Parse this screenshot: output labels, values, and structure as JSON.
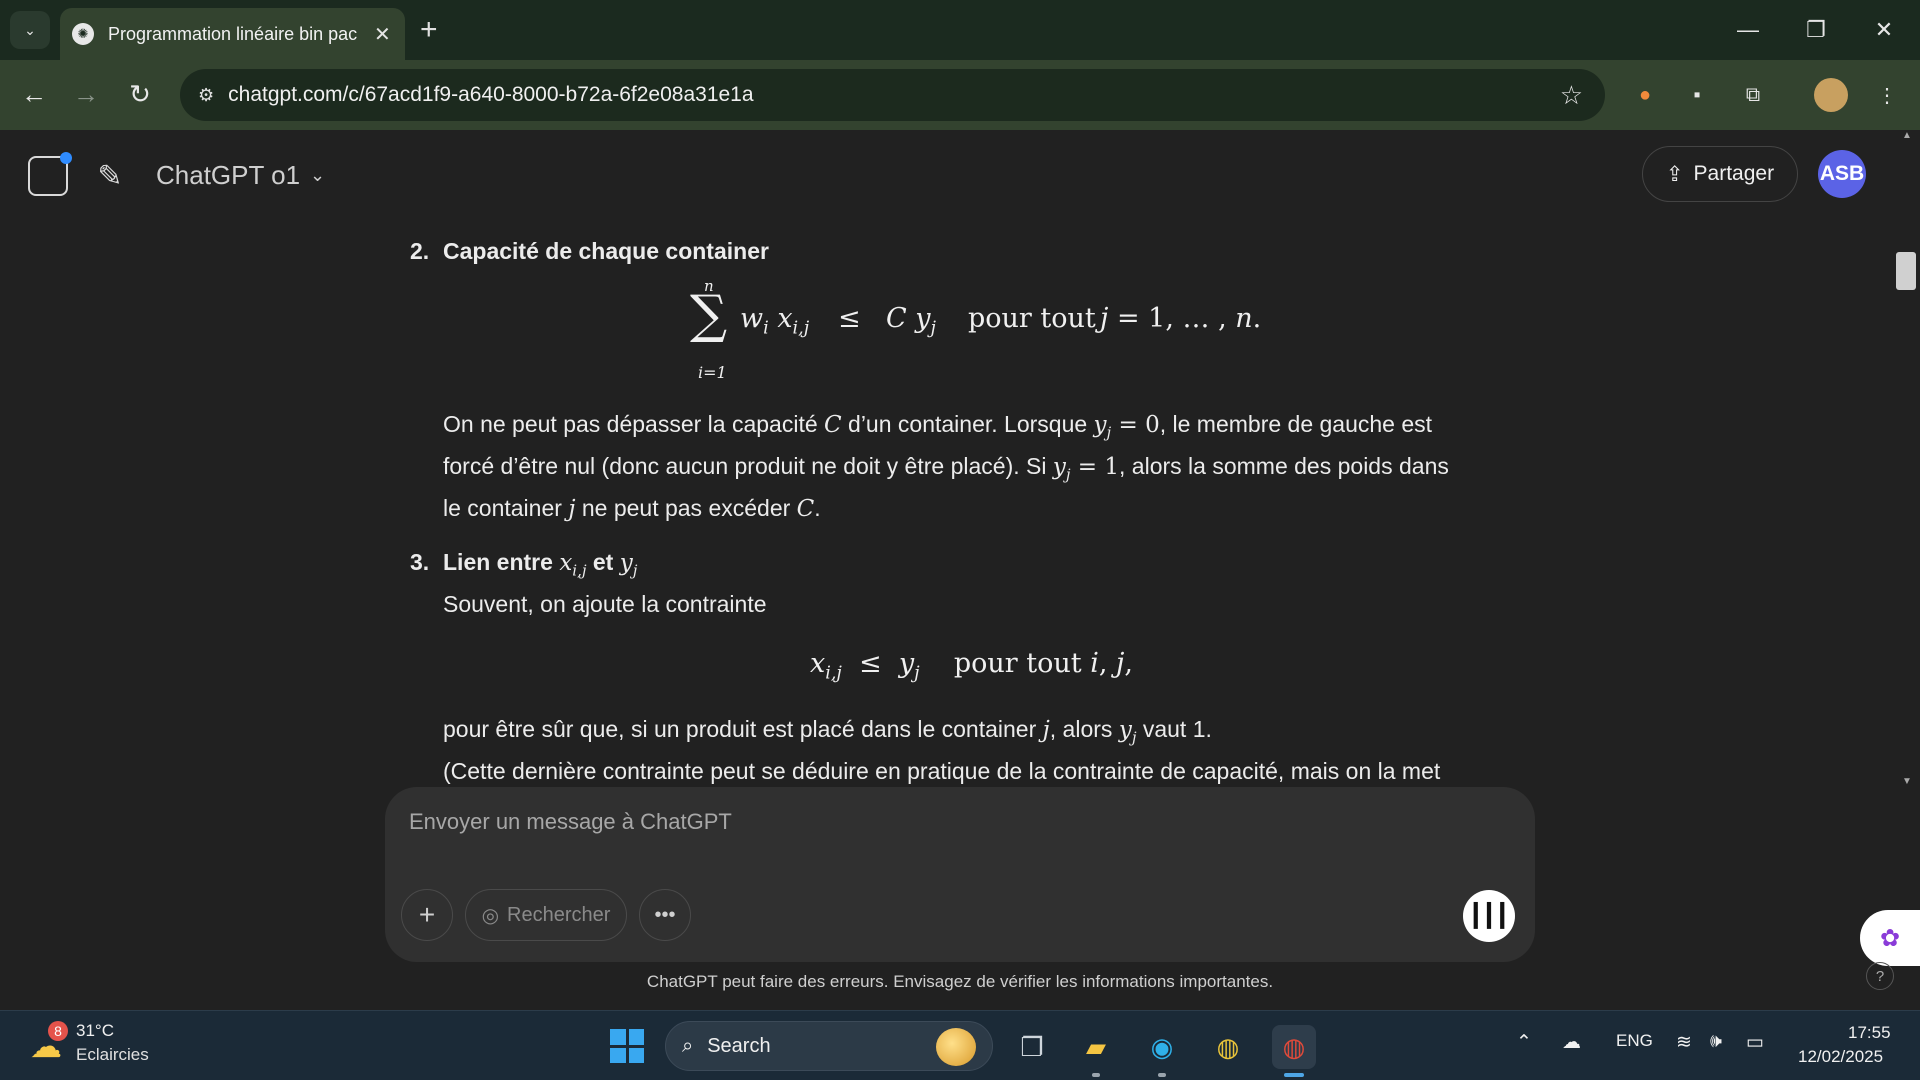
{
  "browser": {
    "tab_title": "Programmation linéaire bin pac",
    "url": "chatgpt.com/c/67acd1f9-a640-8000-b72a-6f2e08a31e1a"
  },
  "header": {
    "model": "ChatGPT o1",
    "share_label": "Partager",
    "avatar_initials": "ASB"
  },
  "content": {
    "item2_number": "2.",
    "item2_title": "Capacité de chaque container",
    "item2_eq_pour": "pour tout",
    "item2_p1a": "On ne peut pas dépasser la capacité",
    "item2_p1b": "d’un container. Lorsque",
    "item2_p1c": ", le membre de gauche est",
    "item2_p2a": "forcé d’être nul (donc aucun produit ne doit y être placé). Si",
    "item2_p2b": ", alors la somme des poids dans",
    "item2_p3a": "le container",
    "item2_p3b": "ne peut pas excéder",
    "item3_number": "3.",
    "item3_title_a": "Lien entre",
    "item3_title_b": "et",
    "item3_line1": "Souvent, on ajoute la contrainte",
    "item3_eq_pour": "pour tout",
    "item3_p1a": "pour être sûr que, si un produit est placé dans le container",
    "item3_p1b": ", alors",
    "item3_p1c": "vaut 1.",
    "item3_p2": "(Cette dernière contrainte peut se déduire en pratique de la contrainte de capacité, mais on la met"
  },
  "composer": {
    "placeholder": "Envoyer un message à ChatGPT",
    "search_label": "Rechercher"
  },
  "disclaimer": "ChatGPT peut faire des erreurs. Envisagez de vérifier les informations importantes.",
  "taskbar": {
    "weather_badge": "8",
    "weather_temp": "31°C",
    "weather_condition": "Eclaircies",
    "search_label": "Search",
    "language": "ENG",
    "time": "17:55",
    "date": "12/02/2025"
  }
}
